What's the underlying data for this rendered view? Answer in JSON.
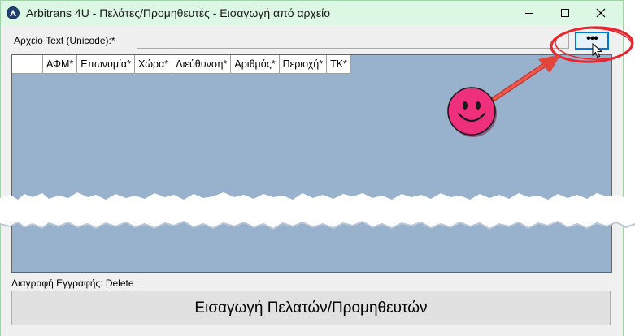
{
  "window": {
    "title": "Arbitrans 4U - Πελάτες/Προμηθευτές - Εισαγωγή από αρχείο",
    "controls": [
      "minimize-icon",
      "maximize-icon",
      "close-icon"
    ]
  },
  "file": {
    "label": "Αρχείο Text (Unicode):*",
    "value": "",
    "browse_label": "•••"
  },
  "grid": {
    "columns": [
      "ΑΦΜ*",
      "Επωνυμία*",
      "Χώρα*",
      "Διεύθυνση*",
      "Αριθμός*",
      "Περιοχή*",
      "ΤΚ*"
    ],
    "rows": []
  },
  "footer": {
    "delete_hint": "Διαγραφή Εγγραφής: Delete",
    "import_label": "Εισαγωγή Πελατών/Προμηθευτών"
  },
  "annotations": {
    "highlight_color": "#e8262e",
    "arrow_color": "#e3453a",
    "smiley_color": "#ee2f7c"
  }
}
